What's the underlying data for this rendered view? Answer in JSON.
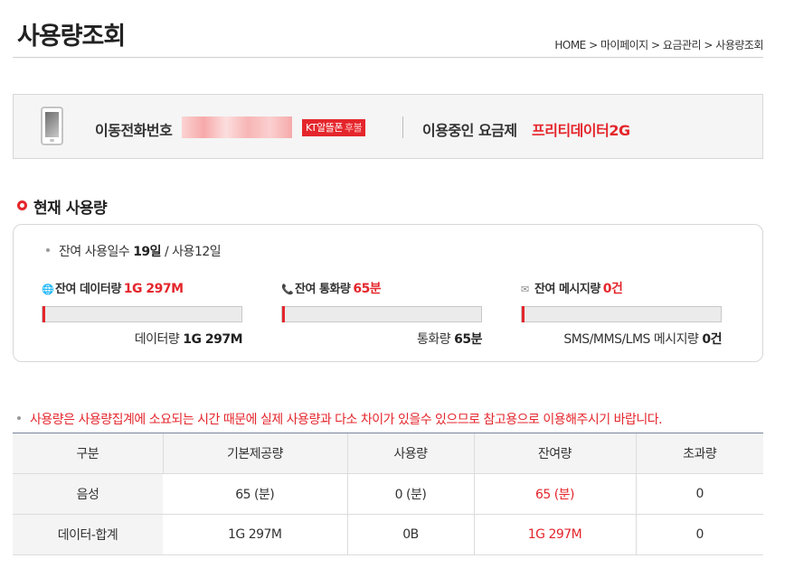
{
  "page": {
    "title": "사용량조회",
    "breadcrumb": [
      "HOME",
      "마이페이지",
      "요금관리",
      "사용량조회"
    ],
    "breadcrumb_separator": ">"
  },
  "subscription": {
    "phone_label": "이동전화번호",
    "carrier_badge": "KT알뜰폰",
    "carrier_badge_type": "후불",
    "plan_label": "이용중인 요금제",
    "plan_name": "프리티데이터2G",
    "phone_icon": "mobile-phone-icon"
  },
  "current_usage": {
    "heading": "현재 사용량",
    "days": {
      "prefix": "잔여 사용일수 ",
      "remaining": "19일",
      "separator": " / 사용",
      "used": "12일"
    },
    "meters": [
      {
        "icon": "globe-icon",
        "icon_glyph": "🌐",
        "label": "잔여 데이터량",
        "value": "1G 297M",
        "remaining_fraction": 0.0,
        "footer_label": "데이터량 ",
        "footer_value": "1G 297M"
      },
      {
        "icon": "phone-icon",
        "icon_glyph": "📞",
        "label": "잔여 통화량",
        "value": "65분",
        "remaining_fraction": 0.0,
        "footer_label": "통화량 ",
        "footer_value": "65분"
      },
      {
        "icon": "envelope-icon",
        "icon_glyph": "✉",
        "label": "잔여 메시지량",
        "value": "0건",
        "remaining_fraction": 0.0,
        "footer_label": "SMS/MMS/LMS 메시지량 ",
        "footer_value": "0건"
      }
    ]
  },
  "notice": "사용량은 사용량집계에 소요되는 시간 때문에 실제 사용량과 다소 차이가 있을수 있으므로 참고용으로 이용해주시기 바랍니다.",
  "table": {
    "headers": [
      "구분",
      "기본제공량",
      "사용량",
      "잔여량",
      "초과량"
    ],
    "rows": [
      {
        "category": "음성",
        "base": "65 (분)",
        "used": "0 (분)",
        "remaining": "65 (분)",
        "excess": "0"
      },
      {
        "category": "데이터-합계",
        "base": "1G 297M",
        "used": "0B",
        "remaining": "1G 297M",
        "excess": "0"
      }
    ]
  },
  "colors": {
    "accent": "#e4262c",
    "masked_number": "#f7a9a9",
    "border": "#d7d7d7",
    "table_top_border": "#7a8599"
  }
}
